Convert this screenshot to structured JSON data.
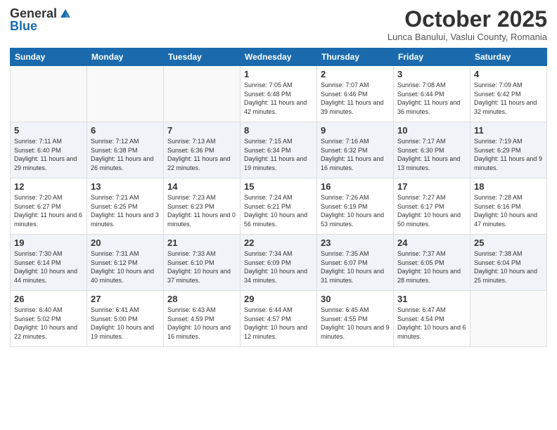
{
  "logo": {
    "general": "General",
    "blue": "Blue"
  },
  "header": {
    "month": "October 2025",
    "location": "Lunca Banului, Vaslui County, Romania"
  },
  "weekdays": [
    "Sunday",
    "Monday",
    "Tuesday",
    "Wednesday",
    "Thursday",
    "Friday",
    "Saturday"
  ],
  "weeks": [
    [
      {
        "day": "",
        "info": ""
      },
      {
        "day": "",
        "info": ""
      },
      {
        "day": "",
        "info": ""
      },
      {
        "day": "1",
        "info": "Sunrise: 7:05 AM\nSunset: 6:48 PM\nDaylight: 11 hours and 42 minutes."
      },
      {
        "day": "2",
        "info": "Sunrise: 7:07 AM\nSunset: 6:46 PM\nDaylight: 11 hours and 39 minutes."
      },
      {
        "day": "3",
        "info": "Sunrise: 7:08 AM\nSunset: 6:44 PM\nDaylight: 11 hours and 36 minutes."
      },
      {
        "day": "4",
        "info": "Sunrise: 7:09 AM\nSunset: 6:42 PM\nDaylight: 11 hours and 32 minutes."
      }
    ],
    [
      {
        "day": "5",
        "info": "Sunrise: 7:11 AM\nSunset: 6:40 PM\nDaylight: 11 hours and 29 minutes."
      },
      {
        "day": "6",
        "info": "Sunrise: 7:12 AM\nSunset: 6:38 PM\nDaylight: 11 hours and 26 minutes."
      },
      {
        "day": "7",
        "info": "Sunrise: 7:13 AM\nSunset: 6:36 PM\nDaylight: 11 hours and 22 minutes."
      },
      {
        "day": "8",
        "info": "Sunrise: 7:15 AM\nSunset: 6:34 PM\nDaylight: 11 hours and 19 minutes."
      },
      {
        "day": "9",
        "info": "Sunrise: 7:16 AM\nSunset: 6:32 PM\nDaylight: 11 hours and 16 minutes."
      },
      {
        "day": "10",
        "info": "Sunrise: 7:17 AM\nSunset: 6:30 PM\nDaylight: 11 hours and 13 minutes."
      },
      {
        "day": "11",
        "info": "Sunrise: 7:19 AM\nSunset: 6:29 PM\nDaylight: 11 hours and 9 minutes."
      }
    ],
    [
      {
        "day": "12",
        "info": "Sunrise: 7:20 AM\nSunset: 6:27 PM\nDaylight: 11 hours and 6 minutes."
      },
      {
        "day": "13",
        "info": "Sunrise: 7:21 AM\nSunset: 6:25 PM\nDaylight: 11 hours and 3 minutes."
      },
      {
        "day": "14",
        "info": "Sunrise: 7:23 AM\nSunset: 6:23 PM\nDaylight: 11 hours and 0 minutes."
      },
      {
        "day": "15",
        "info": "Sunrise: 7:24 AM\nSunset: 6:21 PM\nDaylight: 10 hours and 56 minutes."
      },
      {
        "day": "16",
        "info": "Sunrise: 7:26 AM\nSunset: 6:19 PM\nDaylight: 10 hours and 53 minutes."
      },
      {
        "day": "17",
        "info": "Sunrise: 7:27 AM\nSunset: 6:17 PM\nDaylight: 10 hours and 50 minutes."
      },
      {
        "day": "18",
        "info": "Sunrise: 7:28 AM\nSunset: 6:16 PM\nDaylight: 10 hours and 47 minutes."
      }
    ],
    [
      {
        "day": "19",
        "info": "Sunrise: 7:30 AM\nSunset: 6:14 PM\nDaylight: 10 hours and 44 minutes."
      },
      {
        "day": "20",
        "info": "Sunrise: 7:31 AM\nSunset: 6:12 PM\nDaylight: 10 hours and 40 minutes."
      },
      {
        "day": "21",
        "info": "Sunrise: 7:33 AM\nSunset: 6:10 PM\nDaylight: 10 hours and 37 minutes."
      },
      {
        "day": "22",
        "info": "Sunrise: 7:34 AM\nSunset: 6:09 PM\nDaylight: 10 hours and 34 minutes."
      },
      {
        "day": "23",
        "info": "Sunrise: 7:35 AM\nSunset: 6:07 PM\nDaylight: 10 hours and 31 minutes."
      },
      {
        "day": "24",
        "info": "Sunrise: 7:37 AM\nSunset: 6:05 PM\nDaylight: 10 hours and 28 minutes."
      },
      {
        "day": "25",
        "info": "Sunrise: 7:38 AM\nSunset: 6:04 PM\nDaylight: 10 hours and 25 minutes."
      }
    ],
    [
      {
        "day": "26",
        "info": "Sunrise: 6:40 AM\nSunset: 5:02 PM\nDaylight: 10 hours and 22 minutes."
      },
      {
        "day": "27",
        "info": "Sunrise: 6:41 AM\nSunset: 5:00 PM\nDaylight: 10 hours and 19 minutes."
      },
      {
        "day": "28",
        "info": "Sunrise: 6:43 AM\nSunset: 4:59 PM\nDaylight: 10 hours and 16 minutes."
      },
      {
        "day": "29",
        "info": "Sunrise: 6:44 AM\nSunset: 4:57 PM\nDaylight: 10 hours and 12 minutes."
      },
      {
        "day": "30",
        "info": "Sunrise: 6:45 AM\nSunset: 4:55 PM\nDaylight: 10 hours and 9 minutes."
      },
      {
        "day": "31",
        "info": "Sunrise: 6:47 AM\nSunset: 4:54 PM\nDaylight: 10 hours and 6 minutes."
      },
      {
        "day": "",
        "info": ""
      }
    ]
  ]
}
